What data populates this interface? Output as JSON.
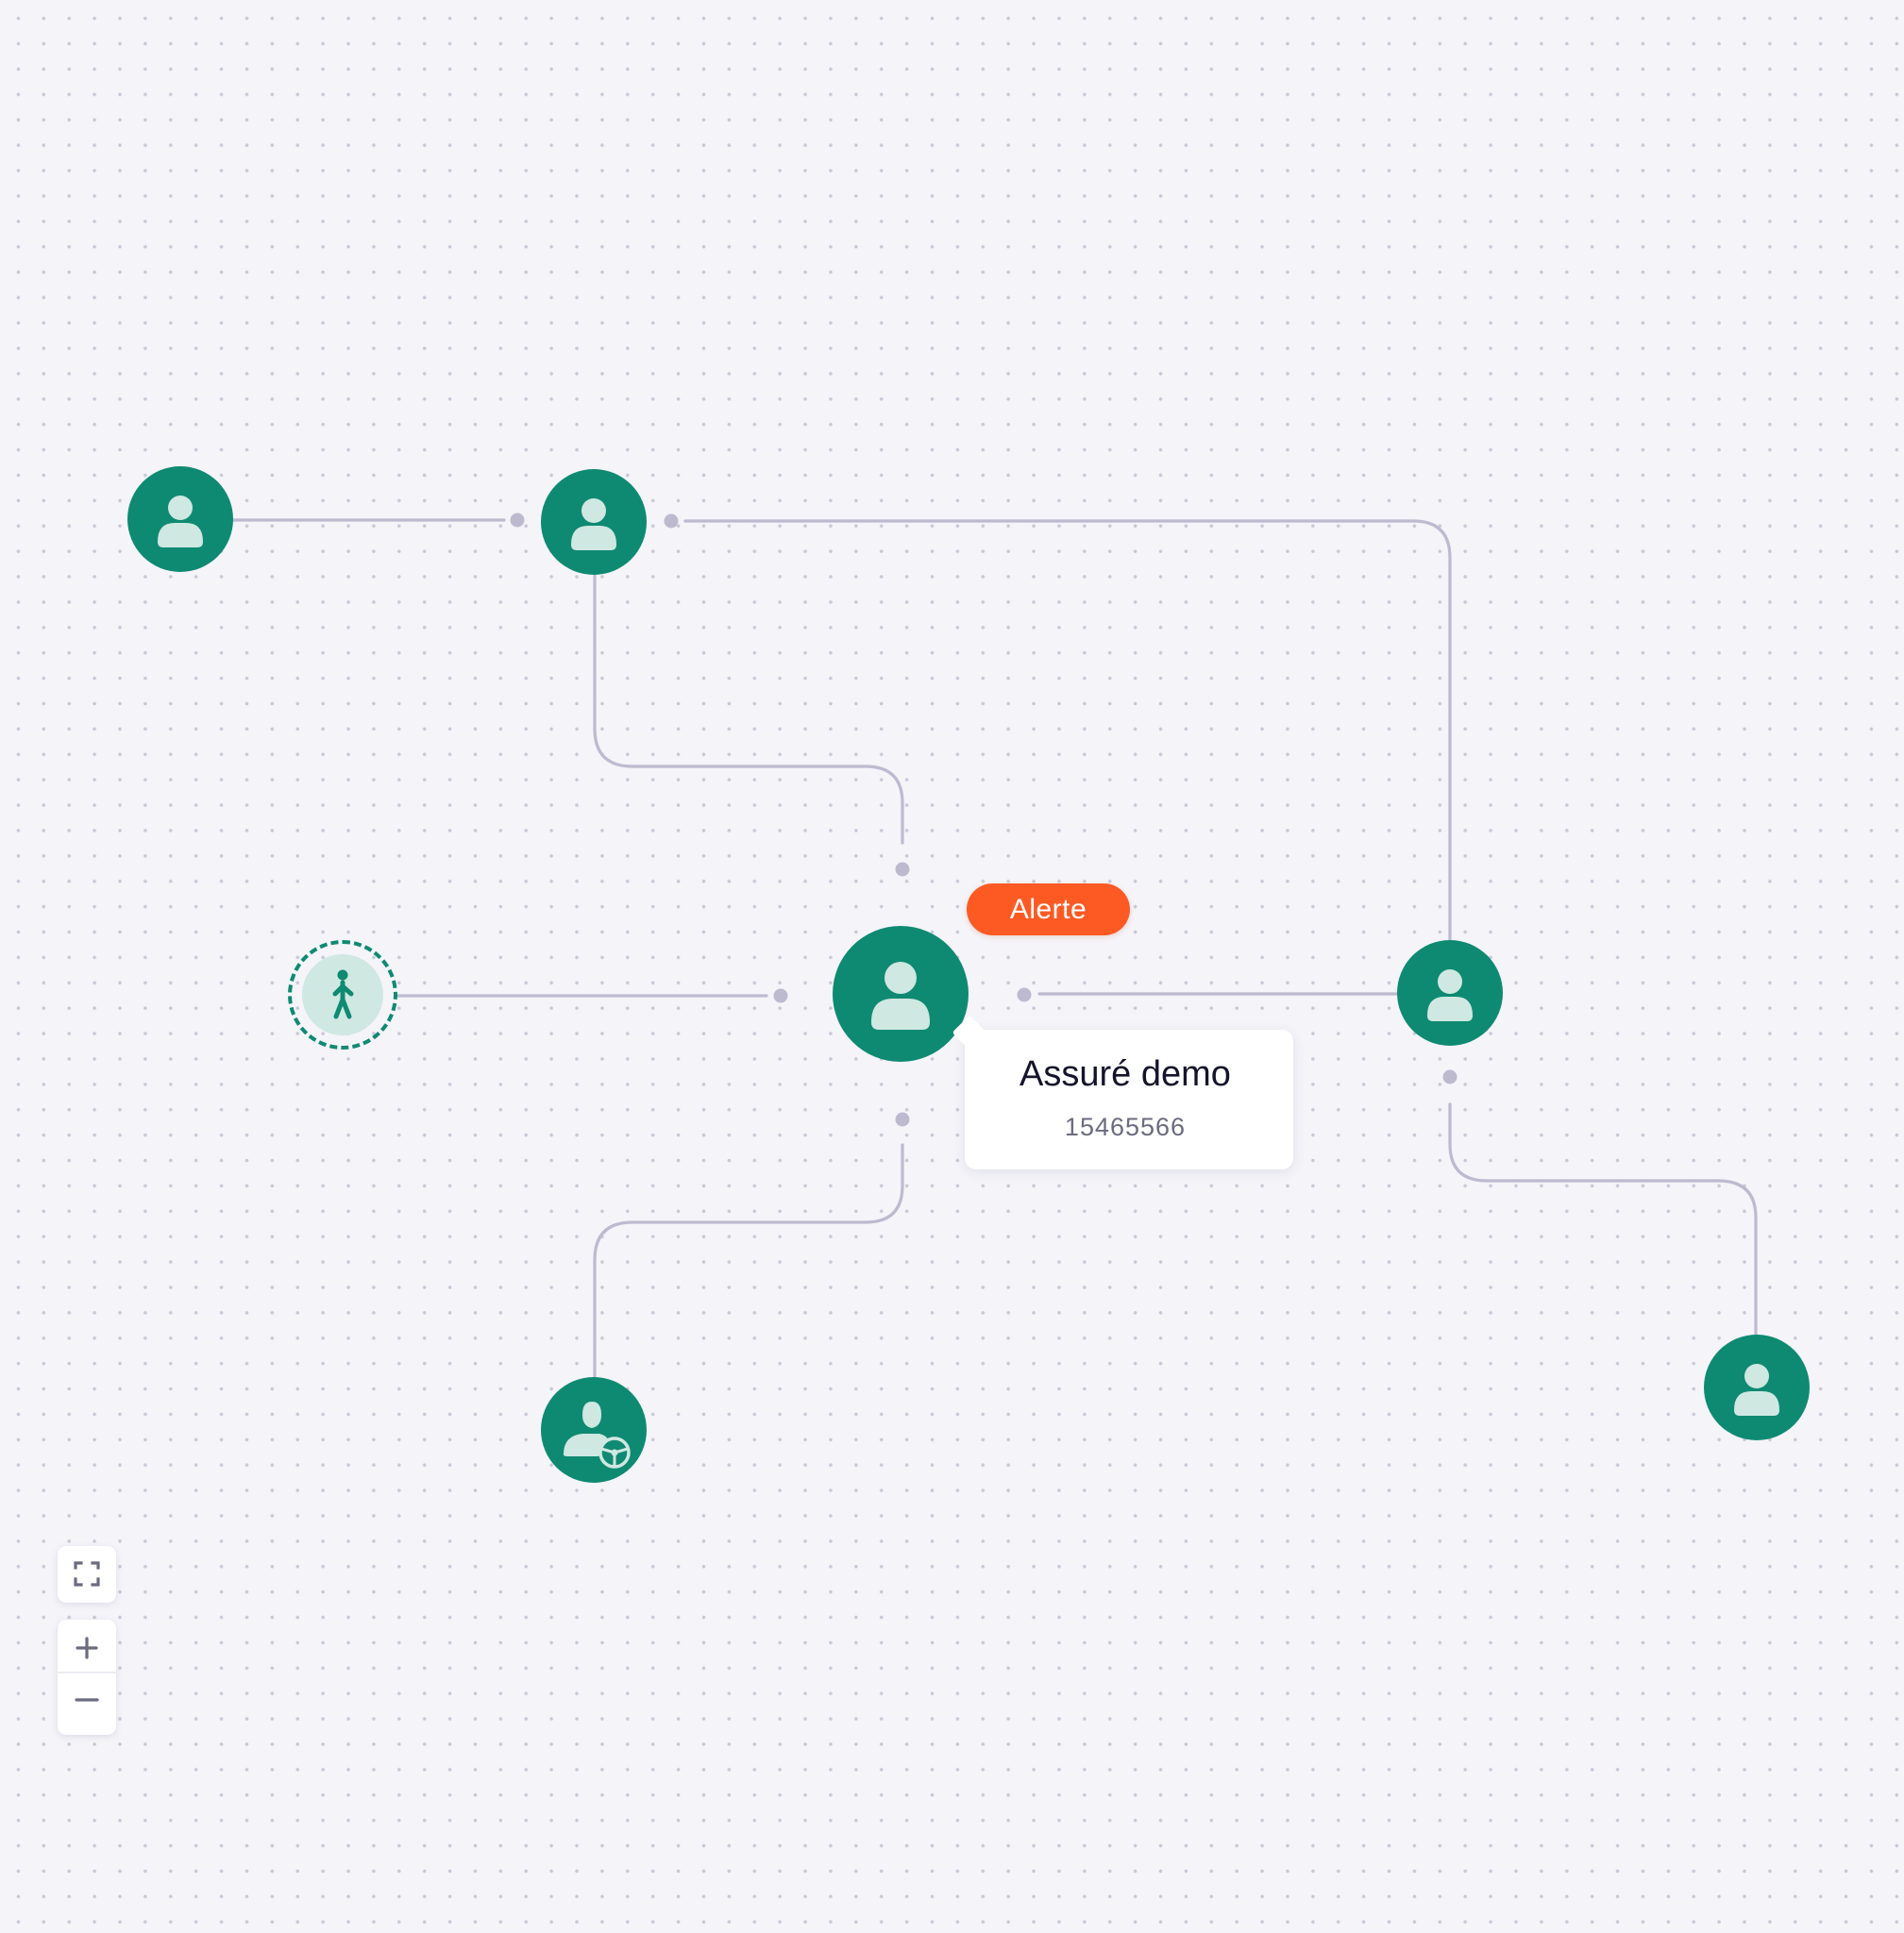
{
  "graph": {
    "focused_node": {
      "badge": "Alerte",
      "name": "Assuré demo",
      "id_number": "15465566"
    },
    "node_icons": [
      "person-icon",
      "pedestrian-icon",
      "driver-icon"
    ]
  },
  "colors": {
    "node": "#0f8a72",
    "node_icon": "#cfe8e2",
    "edge": "#bdbad0",
    "alert": "#fd5a23",
    "background": "#f4f4f9"
  },
  "controls": [
    "fit-view",
    "zoom-in",
    "zoom-out"
  ]
}
